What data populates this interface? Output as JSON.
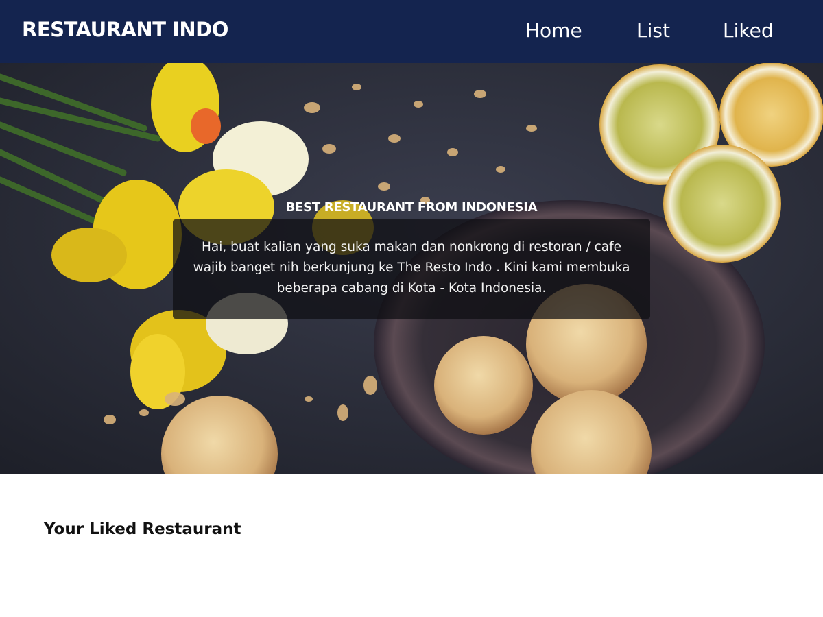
{
  "header": {
    "brand": "RESTAURANT INDO",
    "nav": [
      {
        "label": "Home"
      },
      {
        "label": "List"
      },
      {
        "label": "Liked"
      }
    ],
    "background_color": "#14244f"
  },
  "hero": {
    "title": "BEST RESTAURANT FROM INDONESIA",
    "description": "Hai, buat kalian yang suka makan dan nonkrong di restoran / cafe wajib banget nih berkunjung ke The Resto Indo . Kini kami membuka beberapa cabang di Kota - Kota Indonesia."
  },
  "content": {
    "title": "Your Liked Restaurant"
  }
}
